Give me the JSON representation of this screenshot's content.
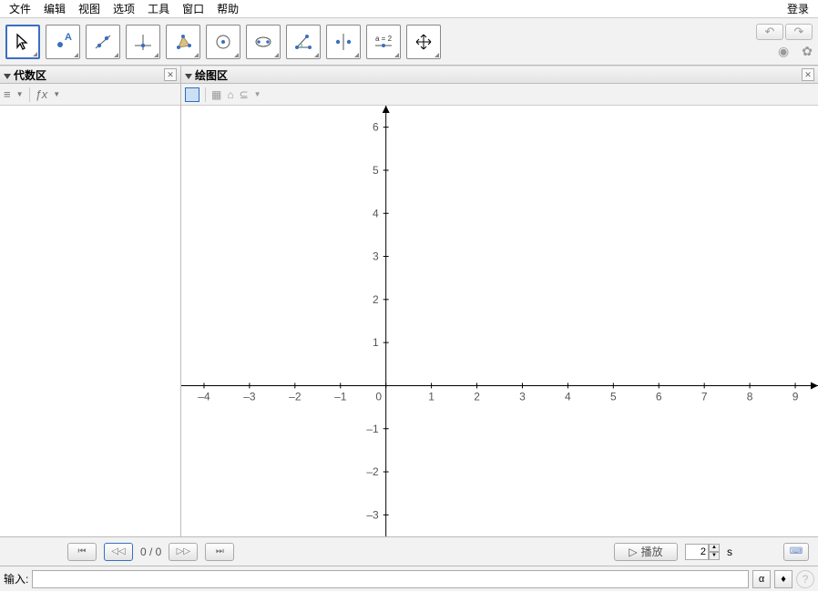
{
  "menu": {
    "items": [
      "文件",
      "编辑",
      "视图",
      "选项",
      "工具",
      "窗口",
      "帮助"
    ],
    "login": "登录"
  },
  "toolbar": {
    "tools": [
      "移动",
      "点",
      "直线",
      "垂线",
      "多边形",
      "圆",
      "圆锥曲线",
      "角度",
      "对称",
      "滑动条",
      "移动视图"
    ],
    "slider_text": "a = 2"
  },
  "panels": {
    "algebra": "代数区",
    "graphics": "绘图区"
  },
  "algebra_toolbar": {
    "sort": "≡",
    "fx": "ƒx"
  },
  "gfx_toolbar": {
    "home": "⌂",
    "magnet": "⊆"
  },
  "chart_data": {
    "type": "scatter",
    "x": [],
    "y": [],
    "xlim": [
      -4.5,
      9.5
    ],
    "ylim": [
      -3.5,
      6.5
    ],
    "xlabel": "",
    "ylabel": "",
    "title": "",
    "x_ticks": [
      -4,
      -3,
      -2,
      -1,
      0,
      1,
      2,
      3,
      4,
      5,
      6,
      7,
      8,
      9
    ],
    "y_ticks": [
      -3,
      -2,
      -1,
      1,
      2,
      3,
      4,
      5,
      6
    ]
  },
  "nav": {
    "counter": "0 / 0",
    "play": "播放",
    "speed_value": "2",
    "speed_unit": "s"
  },
  "input": {
    "label": "输入:",
    "value": "",
    "placeholder": "",
    "alpha": "α"
  }
}
